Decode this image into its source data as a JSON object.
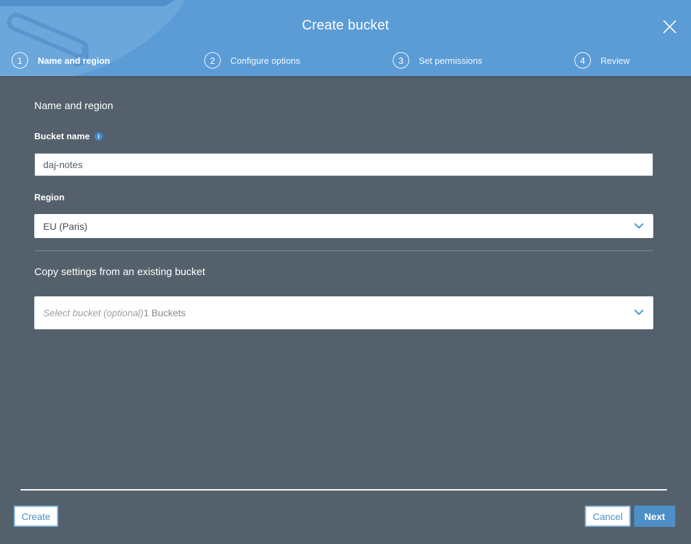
{
  "header": {
    "title": "Create bucket",
    "steps": [
      {
        "number": "1",
        "label": "Name and region",
        "active": true
      },
      {
        "number": "2",
        "label": "Configure options",
        "active": false
      },
      {
        "number": "3",
        "label": "Set permissions",
        "active": false
      },
      {
        "number": "4",
        "label": "Review",
        "active": false
      }
    ]
  },
  "form": {
    "section_title": "Name and region",
    "bucket_name": {
      "label": "Bucket name",
      "value": "daj-notes"
    },
    "region": {
      "label": "Region",
      "selected": "EU (Paris)"
    },
    "copy_settings": {
      "title": "Copy settings from an existing bucket",
      "placeholder": "Select bucket (optional)",
      "bucket_count": "1 Buckets"
    }
  },
  "footer": {
    "create_label": "Create",
    "cancel_label": "Cancel",
    "next_label": "Next"
  },
  "icons": {
    "info_glyph": "i"
  },
  "colors": {
    "header_blue": "#5b9cd6",
    "body_slate": "#54616d",
    "accent_blue": "#4a90c8",
    "primary_button_blue": "#4e8fc7"
  }
}
